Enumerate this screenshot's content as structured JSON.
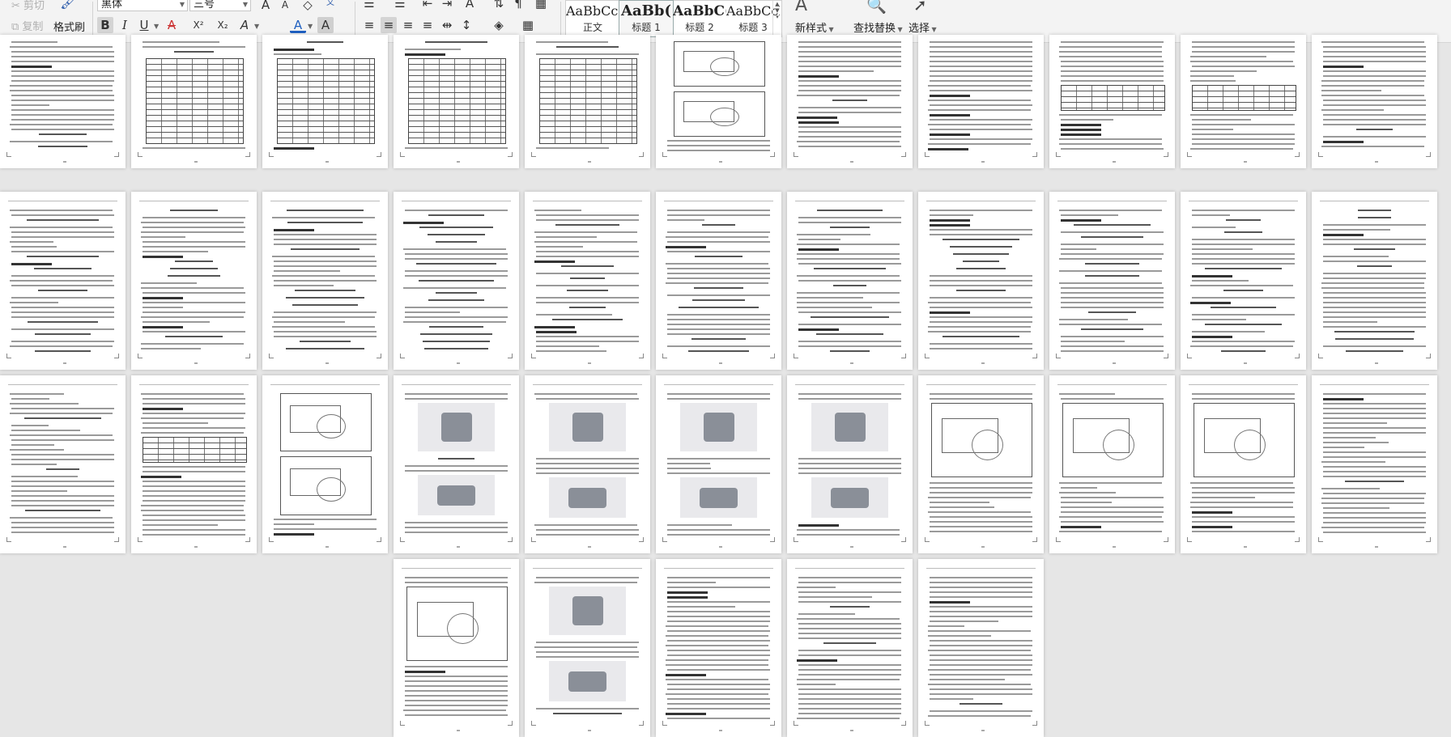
{
  "ribbon": {
    "clipboard": {
      "cut": "剪切",
      "copy": "复制",
      "format_painter": "格式刷"
    },
    "font": {
      "name": "黑体",
      "size": "三号"
    },
    "text_buttons": {
      "bold": "B",
      "italic": "I",
      "underline": "U",
      "strike": "A",
      "superscript": "X²",
      "subscript": "X₂",
      "text_effect": "A",
      "font_color": "A",
      "char_shading": "A",
      "grow": "A",
      "shrink": "A",
      "clear": "◇",
      "phonetic": "文"
    },
    "styles": [
      {
        "sample": "AaBbCcI",
        "name": "正文",
        "bold": false
      },
      {
        "sample": "AaBb(",
        "name": "标题 1",
        "bold": true
      },
      {
        "sample": "AaBbC(",
        "name": "标题 2",
        "bold": false
      },
      {
        "sample": "AaBbCcI",
        "name": "标题 3",
        "bold": false
      }
    ],
    "new_style": "新样式",
    "find_replace": "查找替换",
    "select": "选择"
  }
}
